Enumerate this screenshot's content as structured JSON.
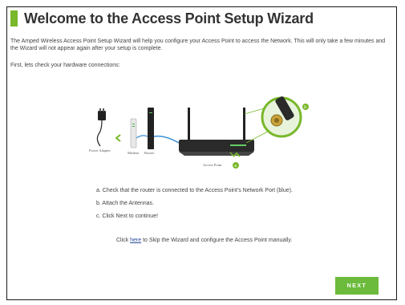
{
  "title": "Welcome to the Access Point Setup Wizard",
  "intro": "The Amped Wireless Access Point Setup Wizard will help you configure your Access Point to access the Network. This will only take a few minutes and the Wizard will not appear again after your setup is complete.",
  "check_hardware": "First, lets check your hardware connections:",
  "diagram": {
    "power_adapter_label": "Power Adapter",
    "modem_label": "Modem",
    "router_label": "Router",
    "access_point_label": "Access Point",
    "marker_a": "a",
    "marker_b": "b",
    "accent_color": "#78b82a",
    "cable_color": "#3a8fd6"
  },
  "instructions": {
    "a": "a. Check that the router is connected to the Access Point's Network Port (blue).",
    "b": "b. Attach the Antennas.",
    "c": "c. Click Next to continue!"
  },
  "skip": {
    "prefix": "Click ",
    "link": "here",
    "suffix": " to Skip the Wizard and configure the Access Point manually."
  },
  "next_label": "NEXT"
}
